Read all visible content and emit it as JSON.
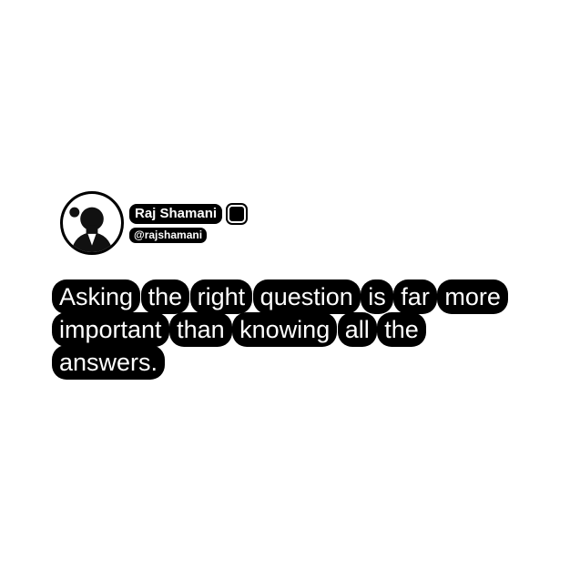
{
  "post": {
    "author": {
      "name": "Raj Shamani",
      "handle": "@rajshamani",
      "avatar_icon": "profile-photo-icon",
      "verified_icon": "verified-badge-icon"
    },
    "quote_words": [
      "Asking",
      "the",
      "right",
      "question",
      "is",
      "far",
      "more",
      "important",
      "than",
      "knowing",
      "all",
      "the",
      "answers."
    ]
  },
  "colors": {
    "background": "#ffffff",
    "text_outline": "#000000",
    "text": "#ffffff"
  }
}
